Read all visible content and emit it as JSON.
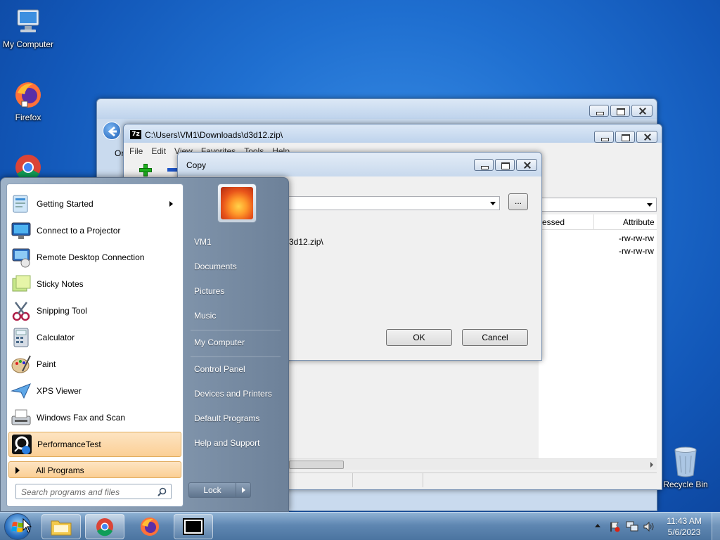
{
  "desktop": {
    "icons": [
      {
        "label": "My Computer",
        "icon": "monitor-icon"
      },
      {
        "label": "Firefox",
        "icon": "firefox-icon"
      },
      {
        "label": "",
        "icon": "chrome-icon"
      },
      {
        "label": "Recycle Bin",
        "icon": "recycle-bin-icon"
      }
    ]
  },
  "zip_window": {
    "title": "C:\\Users\\VM1\\Downloads\\d3d12.zip\\",
    "menu": [
      "File",
      "Edit",
      "View",
      "Favorites",
      "Tools",
      "Help"
    ],
    "columns": {
      "compressed_partial": "essed",
      "attributes": "Attribute"
    },
    "rows": [
      "-rw-rw-rw",
      "-rw-rw-rw"
    ]
  },
  "back_window": {
    "partial_text": "Or"
  },
  "copy_dialog": {
    "title": "Copy",
    "browse_label": "...",
    "path_partial": "3d12.zip\\",
    "ok_label": "OK",
    "cancel_label": "Cancel"
  },
  "start_menu": {
    "programs": [
      {
        "label": "Getting Started",
        "icon": "getting-started-icon",
        "submenu": true
      },
      {
        "label": "Connect to a Projector",
        "icon": "projector-icon"
      },
      {
        "label": "Remote Desktop Connection",
        "icon": "remote-desktop-icon"
      },
      {
        "label": "Sticky Notes",
        "icon": "sticky-notes-icon"
      },
      {
        "label": "Snipping Tool",
        "icon": "scissors-icon"
      },
      {
        "label": "Calculator",
        "icon": "calculator-icon"
      },
      {
        "label": "Paint",
        "icon": "paint-palette-icon"
      },
      {
        "label": "XPS Viewer",
        "icon": "xps-viewer-icon"
      },
      {
        "label": "Windows Fax and Scan",
        "icon": "fax-icon"
      },
      {
        "label": "PerformanceTest",
        "icon": "performancetest-icon",
        "highlighted": true
      }
    ],
    "all_programs": "All Programs",
    "search_placeholder": "Search programs and files",
    "user": "VM1",
    "places": [
      "Documents",
      "Pictures",
      "Music",
      "My Computer",
      "Control Panel",
      "Devices and Printers",
      "Default Programs",
      "Help and Support"
    ],
    "lock_label": "Lock"
  },
  "taskbar": {
    "apps": [
      "file-explorer-icon",
      "chrome-icon",
      "firefox-icon",
      "7zip-icon"
    ],
    "time": "11:43 AM",
    "date": "5/6/2023",
    "tray_icons": [
      "show-hidden-icons-chevron",
      "action-center-flag-icon",
      "network-icon",
      "volume-icon"
    ]
  },
  "colors": {
    "accent_highlight": "#fbcf95",
    "desktop": "#1f6fd0"
  }
}
